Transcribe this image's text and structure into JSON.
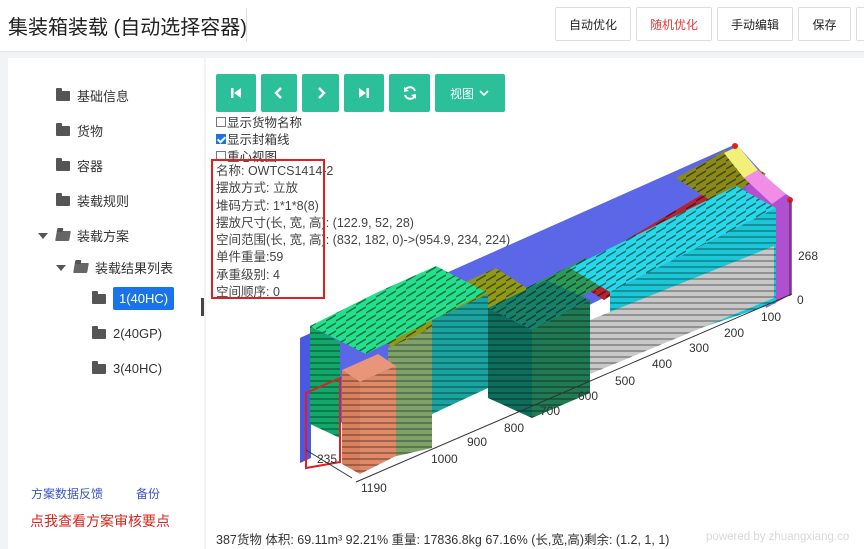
{
  "app": {
    "title": "集装箱装载 (自动选择容器)"
  },
  "toolbar": {
    "auto_optimize": "自动优化",
    "random_optimize": "随机优化",
    "manual_edit": "手动编辑",
    "save": "保存"
  },
  "sidebar": {
    "items": [
      {
        "label": "基础信息"
      },
      {
        "label": "货物"
      },
      {
        "label": "容器"
      },
      {
        "label": "装载规则"
      },
      {
        "label": "装载方案"
      },
      {
        "label": "装载结果列表"
      }
    ],
    "results": [
      "1(40HC)",
      "2(40GP)",
      "3(40HC)"
    ],
    "feedback_link": "方案数据反馈",
    "backup_link": "备份",
    "review_link": "点我查看方案审核要点"
  },
  "viewer": {
    "view_button": "视图",
    "options": [
      {
        "label": "显示货物名称",
        "checked": false
      },
      {
        "label": "显示封箱线",
        "checked": true
      },
      {
        "label": "重心视图",
        "checked": false
      }
    ],
    "info": [
      "名称: OWTCS1414-2",
      "摆放方式: 立放",
      "堆码方式: 1*1*8(8)",
      "摆放尺寸(长, 宽, 高): (122.9, 52, 28)",
      "空间范围(长, 宽, 高): (832, 182, 0)->(954.9, 234, 224)",
      "单件重量:59",
      "承重级别: 4",
      "空间顺序: 0"
    ],
    "axis_labels": [
      "1190",
      "1000",
      "900",
      "800",
      "700",
      "600",
      "500",
      "400",
      "300",
      "200",
      "100",
      "0",
      "268",
      "235"
    ],
    "status_text": "387货物 体积: 69.11m³ 92.21% 重量: 17836.8kg 67.16% (长,宽,高)剩余: (1.2, 1, 1)",
    "powered_by": "powered by zhuangxiang.co"
  },
  "colors": {
    "accent": "#2bbf9a",
    "selected": "#1a73e8",
    "highlight": "#e02020",
    "container_wall": "#4a5ae0"
  }
}
